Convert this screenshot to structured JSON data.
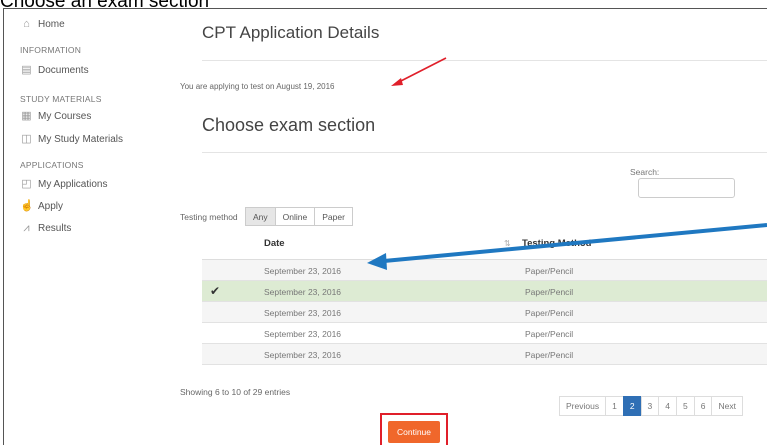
{
  "caption": "Choose an exam section",
  "sidebar": {
    "home": {
      "label": "Home",
      "icon": "home-icon"
    },
    "information_heading": "INFORMATION",
    "documents": {
      "label": "Documents",
      "icon": "document-icon"
    },
    "study_heading": "STUDY MATERIALS",
    "my_courses": {
      "label": "My Courses",
      "icon": "courses-icon"
    },
    "my_study_materials": {
      "label": "My Study Materials",
      "icon": "study-materials-icon"
    },
    "applications_heading": "APPLICATIONS",
    "my_applications": {
      "label": "My Applications",
      "icon": "applications-icon"
    },
    "apply": {
      "label": "Apply",
      "icon": "apply-icon"
    },
    "results": {
      "label": "Results",
      "icon": "results-icon"
    }
  },
  "main": {
    "page_title": "CPT Application Details",
    "applying_text": "You are applying to test on August 19, 2016",
    "section_title": "Choose exam section",
    "search_label": "Search:",
    "search_value": "",
    "testing_method_label": "Testing method",
    "testing_method_options": [
      "Any",
      "Online",
      "Paper"
    ],
    "testing_method_selected": "Any",
    "table": {
      "headers": {
        "date": "Date",
        "method": "Testing Method"
      },
      "rows": [
        {
          "date": "September 23, 2016",
          "method": "Paper/Pencil",
          "selected": false
        },
        {
          "date": "September 23, 2016",
          "method": "Paper/Pencil",
          "selected": true
        },
        {
          "date": "September 23, 2016",
          "method": "Paper/Pencil",
          "selected": false
        },
        {
          "date": "September 23, 2016",
          "method": "Paper/Pencil",
          "selected": false
        },
        {
          "date": "September 23, 2016",
          "method": "Paper/Pencil",
          "selected": false
        }
      ],
      "check_mark": "✔"
    },
    "showing_text": "Showing 6 to 10 of 29 entries",
    "pagination": {
      "previous": "Previous",
      "pages": [
        "1",
        "2",
        "3",
        "4",
        "5",
        "6"
      ],
      "current": "2",
      "next": "Next"
    },
    "continue_label": "Continue"
  },
  "colors": {
    "accent_blue": "#2f6fb5",
    "continue_orange": "#f0672b",
    "selected_row": "#ddebd3",
    "annotation_red": "#e01f2a",
    "annotation_blue": "#1f78c1"
  }
}
